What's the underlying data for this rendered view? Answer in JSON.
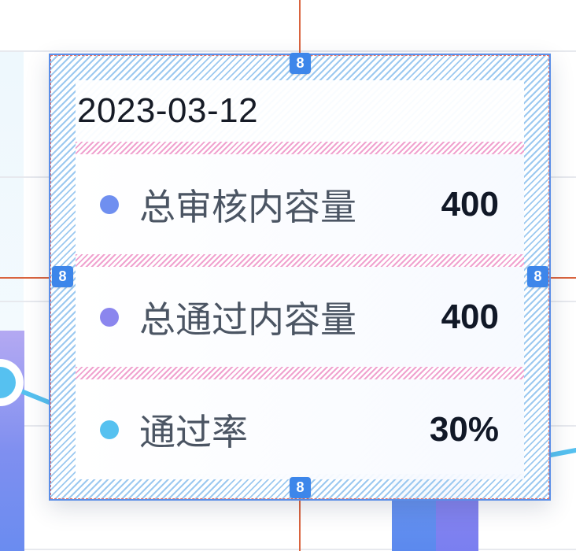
{
  "tooltip": {
    "date": "2023-03-12",
    "items": [
      {
        "label": "总审核内容量",
        "value": "400",
        "color": "#6f8ff0"
      },
      {
        "label": "总通过内容量",
        "value": "400",
        "color": "#8b86ee"
      },
      {
        "label": "通过率",
        "value": "30%",
        "color": "#56c1f0"
      }
    ]
  },
  "spacing_badges": {
    "top": "8",
    "right": "8",
    "bottom": "8",
    "left": "8"
  },
  "colors": {
    "crosshair": "#d9643f",
    "badge": "#3d86ea",
    "tooltip_border": "#5b8fe8"
  }
}
